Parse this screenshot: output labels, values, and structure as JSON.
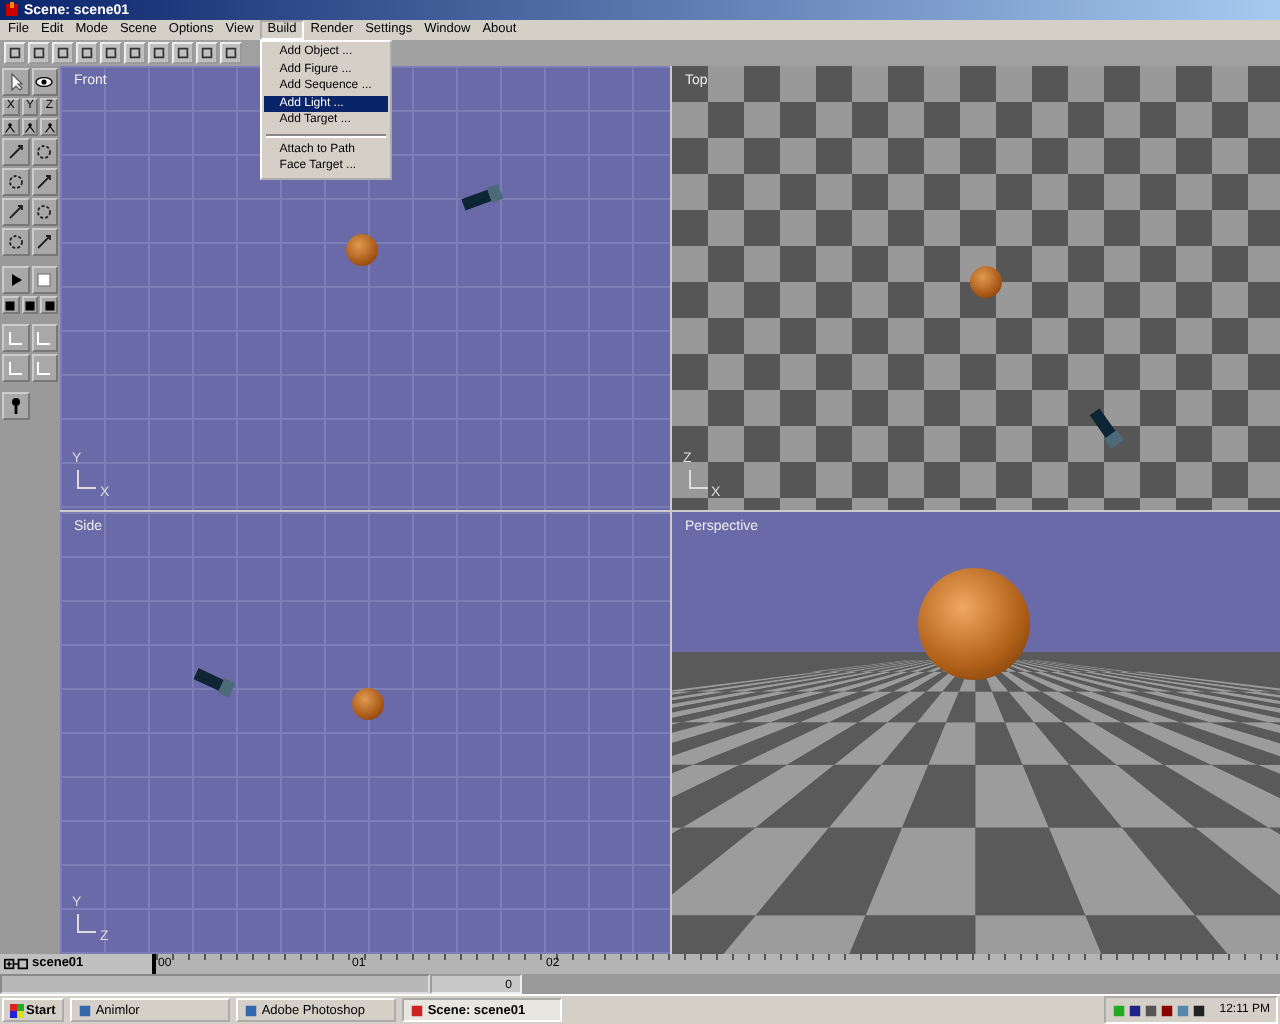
{
  "window": {
    "title": "Scene: scene01"
  },
  "menu": [
    {
      "label": "File",
      "selected": false
    },
    {
      "label": "Edit",
      "selected": false
    },
    {
      "label": "Mode",
      "selected": false
    },
    {
      "label": "Scene",
      "selected": false
    },
    {
      "label": "Options",
      "selected": false
    },
    {
      "label": "View",
      "selected": false
    },
    {
      "label": "Build",
      "selected": true
    },
    {
      "label": "Render",
      "selected": false
    },
    {
      "label": "Settings",
      "selected": false
    },
    {
      "label": "Window",
      "selected": false
    },
    {
      "label": "About",
      "selected": false
    }
  ],
  "dropdown": [
    {
      "kind": "item",
      "label": "Add Object ...",
      "selected": false
    },
    {
      "kind": "item",
      "label": "Add Figure ...",
      "selected": false
    },
    {
      "kind": "item",
      "label": "Add Sequence ...",
      "selected": false
    },
    {
      "kind": "item",
      "label": "Add Light ...",
      "selected": true
    },
    {
      "kind": "item",
      "label": "Add Target ...",
      "selected": false
    },
    {
      "kind": "separator"
    },
    {
      "kind": "item",
      "label": "Attach to Path",
      "selected": false
    },
    {
      "kind": "item",
      "label": "Face Target ...",
      "selected": false
    }
  ],
  "axis_buttons": [
    "X",
    "Y",
    "Z"
  ],
  "viewports": [
    {
      "title": "Front",
      "kind": "grid",
      "axes": [
        "Y",
        "X"
      ]
    },
    {
      "title": "Top",
      "kind": "checker",
      "axes": [
        "Z",
        "X"
      ]
    },
    {
      "title": "Side",
      "kind": "grid",
      "axes": [
        "Y",
        "Z"
      ]
    },
    {
      "title": "Perspective",
      "kind": "perspective"
    }
  ],
  "timeline": {
    "scene": "scene01",
    "ticks": [
      "00",
      "01",
      "02"
    ],
    "frame": "0"
  },
  "taskbar": {
    "start": "Start",
    "tasks": [
      {
        "label": "Animlor",
        "selected": false
      },
      {
        "label": "Adobe Photoshop",
        "selected": false
      },
      {
        "label": "Scene: scene01",
        "selected": true
      }
    ],
    "clock": "12:11 PM"
  }
}
